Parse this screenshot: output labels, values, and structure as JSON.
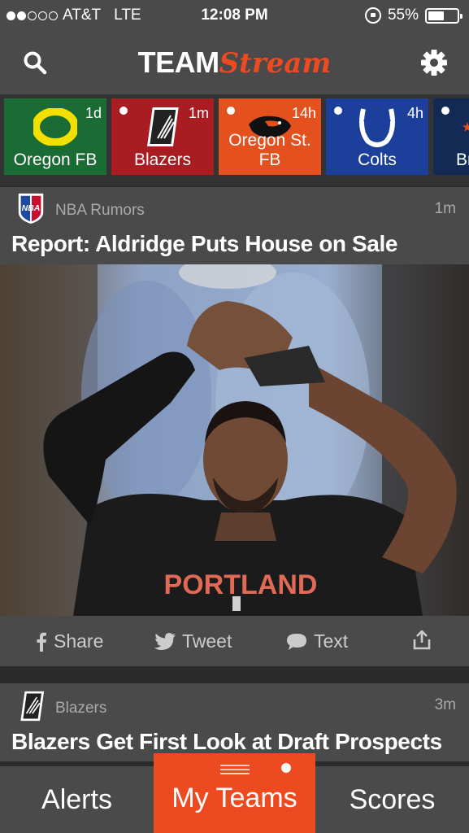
{
  "status": {
    "carrier": "AT&T",
    "network": "LTE",
    "time": "12:08 PM",
    "battery": "55%",
    "battery_level": 0.55
  },
  "header": {
    "logo_team": "TEAM",
    "logo_stream": "Stream",
    "brand_color": "#ee4a22"
  },
  "teams": [
    {
      "name": "Oregon FB",
      "age": "1d",
      "color": "#1a6b34",
      "new": false
    },
    {
      "name": "Blazers",
      "age": "1m",
      "color": "#a81c22",
      "new": true
    },
    {
      "name": "Oregon St. FB",
      "age": "14h",
      "color": "#e5511e",
      "new": true
    },
    {
      "name": "Colts",
      "age": "4h",
      "color": "#1b3f9a",
      "new": true
    },
    {
      "name": "Br",
      "age": "",
      "color": "#132a55",
      "new": true
    }
  ],
  "article1": {
    "source": "NBA Rumors",
    "age": "1m",
    "headline": "Report: Aldridge Puts House on Sale",
    "jersey_text": "PORTLAND"
  },
  "actions": {
    "share": "Share",
    "tweet": "Tweet",
    "text": "Text"
  },
  "article2": {
    "source": "Blazers",
    "age": "3m",
    "headline": "Blazers Get First Look at Draft Prospects"
  },
  "tabs": {
    "alerts": "Alerts",
    "my_teams": "My Teams",
    "scores": "Scores"
  }
}
